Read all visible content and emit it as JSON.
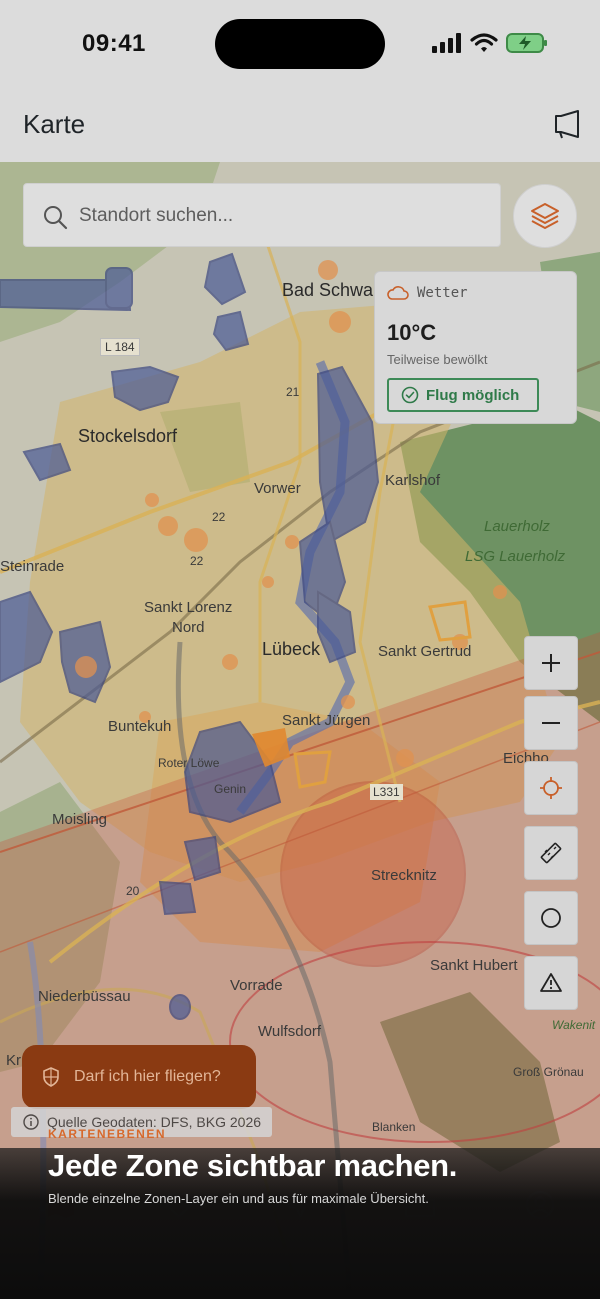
{
  "status_bar": {
    "time": "09:41"
  },
  "header": {
    "title": "Karte",
    "feedback_icon": "megaphone-icon"
  },
  "search": {
    "placeholder": "Standort suchen...",
    "icon": "search-icon"
  },
  "layers_button": {
    "icon": "layers-icon"
  },
  "map": {
    "labels": [
      "Bad Schwa",
      "L 184",
      "21",
      "Stockelsdorf",
      "Vorwer",
      "Karlshof",
      "Lauerholz",
      "LSG Lauerholz",
      "22",
      "22",
      "Steinrade",
      "Sankt Lorenz",
      "Nord",
      "Lübeck",
      "Sankt Gertrud",
      "Buntekuh",
      "Sankt Jürgen",
      "Roter Löwe",
      "Genin",
      "Eichho",
      "L331",
      "Moisling",
      "20",
      "Strecknitz",
      "Sankt Hubert",
      "Vorrade",
      "Niederbüssau",
      "Wulfsdorf",
      "Kr",
      "Wakenit",
      "Groß Grönau",
      "Blanken"
    ],
    "colors": {
      "nature_zone": "#5e8a55",
      "restricted_zone": "#4a5a95",
      "control_zone": "#c8523a",
      "urban": "#d4b56a"
    }
  },
  "weather": {
    "title": "Wetter",
    "icon": "cloud-icon",
    "temperature": "10°C",
    "description": "Teilweise bewölkt",
    "status": "Flug möglich",
    "status_icon": "check-circle-icon",
    "status_color": "#2f7a49"
  },
  "tools": [
    {
      "name": "zoom-in-button",
      "icon": "plus-icon"
    },
    {
      "name": "zoom-out-button",
      "icon": "minus-icon"
    },
    {
      "name": "locate-button",
      "icon": "crosshair-icon"
    },
    {
      "name": "measure-button",
      "icon": "ruler-icon"
    },
    {
      "name": "radius-button",
      "icon": "circle-icon"
    },
    {
      "name": "report-button",
      "icon": "warning-icon"
    }
  ],
  "fly_button": {
    "label": "Darf ich hier fliegen?",
    "icon": "shield-icon"
  },
  "attribution": {
    "text": "Quelle Geodaten: DFS, BKG 2026",
    "icon": "info-icon"
  },
  "onboarding": {
    "kicker": "KARTENEBENEN",
    "title": "Jede Zone sichtbar machen.",
    "subtitle": "Blende einzelne Zonen-Layer ein und aus für maximale Übersicht.",
    "accent": "#d7692c"
  },
  "tabbar": {
    "tabs": [
      {
        "name": "tab-map",
        "icon": "map-icon"
      },
      {
        "name": "tab-favorites",
        "icon": "heart-icon"
      },
      {
        "name": "tab-flight",
        "icon": "drone-icon"
      },
      {
        "name": "tab-logbook",
        "icon": "folder-icon"
      },
      {
        "name": "tab-profile",
        "icon": "profile-icon"
      }
    ]
  }
}
